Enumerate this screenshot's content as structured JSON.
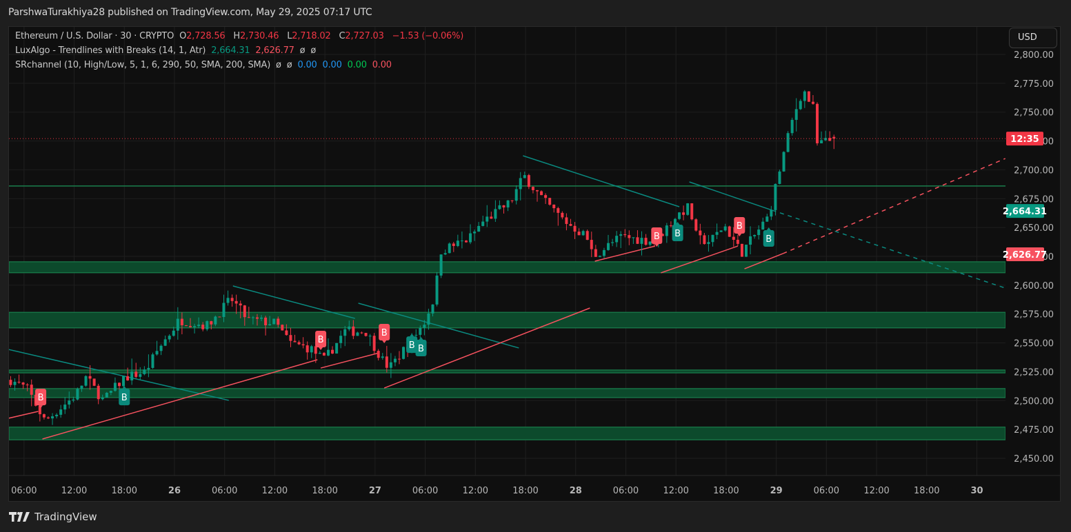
{
  "publisher": "ParshwaTurakhiya28 published on TradingView.com, May 29, 2025 07:17 UTC",
  "legend": {
    "symbol": "Ethereum / U.S. Dollar · 30 · CRYPTO",
    "o_label": "O",
    "o": "2,728.56",
    "h_label": "H",
    "h": "2,730.46",
    "l_label": "L",
    "l": "2,718.02",
    "c_label": "C",
    "c": "2,727.03",
    "change": "−1.53 (−0.06%)",
    "ind1_name": "LuxAlgo - Trendlines with Breaks (14, 1, Atr)",
    "ind1_v1": "2,664.31",
    "ind1_v2": "2,626.77",
    "ind1_v3": "ø",
    "ind1_v4": "ø",
    "ind2_name": "SRchannel (10, High/Low, 5, 1, 6, 290, 50, SMA, 200, SMA)",
    "ind2_v1": "ø",
    "ind2_v2": "ø",
    "ind2_v3": "0.00",
    "ind2_v4": "0.00",
    "ind2_v5": "0.00",
    "ind2_v6": "0.00"
  },
  "currency": "USD",
  "footer": {
    "brand": "TradingView"
  },
  "colors": {
    "up": "#089981",
    "down": "#f23645",
    "zone_fill": "#0c4a2c",
    "zone_border": "#1a7f4d",
    "teal_line": "#0a8a80",
    "red_line": "#f7525f",
    "bg": "#0f0f0f",
    "grid": "#1f1f1f"
  },
  "chart_data": {
    "type": "candlestick",
    "title": "Ethereum / U.S. Dollar · 30 · CRYPTO",
    "time_unit": "hours since May 25 00:00 UTC",
    "interval_hours": 0.5,
    "xlim": [
      3.1,
      122.3
    ],
    "ylim": [
      2435,
      2810
    ],
    "y_ticks": [
      2450,
      2475,
      2500,
      2525,
      2550,
      2575,
      2600,
      2625,
      2650,
      2675,
      2700,
      2725,
      2750,
      2775,
      2800
    ],
    "y_tick_labels": [
      "2,450.00",
      "2,475.00",
      "2,500.00",
      "2,525.00",
      "2,550.00",
      "2,575.00",
      "2,600.00",
      "2,625.00",
      "2,650.00",
      "2,675.00",
      "2,700.00",
      "2,725.00",
      "2,750.00",
      "2,775.00",
      "2,800.00"
    ],
    "x_ticks": [
      {
        "t": 6,
        "label": "06:00"
      },
      {
        "t": 12,
        "label": "12:00"
      },
      {
        "t": 18,
        "label": "18:00"
      },
      {
        "t": 24,
        "label": "26",
        "bold": true
      },
      {
        "t": 30,
        "label": "06:00"
      },
      {
        "t": 36,
        "label": "12:00"
      },
      {
        "t": 42,
        "label": "18:00"
      },
      {
        "t": 48,
        "label": "27",
        "bold": true
      },
      {
        "t": 54,
        "label": "06:00"
      },
      {
        "t": 60,
        "label": "12:00"
      },
      {
        "t": 66,
        "label": "18:00"
      },
      {
        "t": 72,
        "label": "28",
        "bold": true
      },
      {
        "t": 78,
        "label": "06:00"
      },
      {
        "t": 84,
        "label": "12:00"
      },
      {
        "t": 90,
        "label": "18:00"
      },
      {
        "t": 96,
        "label": "29",
        "bold": true
      },
      {
        "t": 102,
        "label": "06:00"
      },
      {
        "t": 108,
        "label": "12:00"
      },
      {
        "t": 114,
        "label": "18:00"
      },
      {
        "t": 120,
        "label": "30",
        "bold": true
      }
    ],
    "close_path": [
      [
        4.4,
        2518
      ],
      [
        6.4,
        2510
      ],
      [
        8.5,
        2482
      ],
      [
        12.2,
        2505
      ],
      [
        13.4,
        2520
      ],
      [
        15.5,
        2500
      ],
      [
        18.0,
        2520
      ],
      [
        20.5,
        2525
      ],
      [
        22.1,
        2545
      ],
      [
        24.6,
        2570
      ],
      [
        27.9,
        2565
      ],
      [
        30.8,
        2588
      ],
      [
        32.8,
        2570
      ],
      [
        36.1,
        2567
      ],
      [
        37.8,
        2550
      ],
      [
        40.3,
        2545
      ],
      [
        41.9,
        2535
      ],
      [
        44.4,
        2560
      ],
      [
        46.9,
        2560
      ],
      [
        48.9,
        2535
      ],
      [
        49.7,
        2528
      ],
      [
        52.6,
        2555
      ],
      [
        53.9,
        2568
      ],
      [
        55.1,
        2590
      ],
      [
        55.9,
        2630
      ],
      [
        59.2,
        2640
      ],
      [
        60.9,
        2655
      ],
      [
        64.2,
        2672
      ],
      [
        65.8,
        2695
      ],
      [
        68.3,
        2672
      ],
      [
        70.8,
        2655
      ],
      [
        73.3,
        2642
      ],
      [
        74.1,
        2625
      ],
      [
        77.4,
        2642
      ],
      [
        81.5,
        2638
      ],
      [
        84.0,
        2660
      ],
      [
        85.6,
        2668
      ],
      [
        86.5,
        2640
      ],
      [
        88.1,
        2638
      ],
      [
        89.8,
        2652
      ],
      [
        91.8,
        2628
      ],
      [
        93.1,
        2640
      ],
      [
        95.1,
        2660
      ],
      [
        96.4,
        2700
      ],
      [
        98.0,
        2745
      ],
      [
        99.2,
        2770
      ],
      [
        100.5,
        2752
      ],
      [
        100.9,
        2722
      ],
      [
        103.0,
        2727.03
      ]
    ],
    "last_candle": {
      "open": 2728.56,
      "high": 2730.46,
      "low": 2718.02,
      "close": 2727.03
    },
    "sr_zones": [
      [
        2610.8,
        2620.3
      ],
      [
        2563.0,
        2576.5
      ],
      [
        2524.0,
        2526.5
      ],
      [
        2502.6,
        2510.4
      ],
      [
        2466.0,
        2477.0
      ]
    ],
    "resistance_line": 2686,
    "current_price_line": 2727.03,
    "price_tags": [
      {
        "label": "12:35",
        "price": 2727.03,
        "color": "#f23645"
      },
      {
        "label": "2,664.31",
        "price": 2664.31,
        "color": "#089981"
      },
      {
        "label": "2,626.77",
        "price": 2626.77,
        "color": "#f7525f"
      }
    ],
    "trendlines_down": [
      [
        [
          4.1,
          2544.4
        ],
        [
          30.5,
          2500.2
        ]
      ],
      [
        [
          31.0,
          2599.3
        ],
        [
          45.6,
          2571.2
        ]
      ],
      [
        [
          46.0,
          2584.4
        ],
        [
          65.2,
          2545.6
        ]
      ],
      [
        [
          65.7,
          2712.2
        ],
        [
          84.4,
          2668.0
        ]
      ],
      [
        [
          85.6,
          2689.5
        ],
        [
          95.5,
          2665.0
        ],
        [
          123.4,
          2597.5
        ]
      ]
    ],
    "trendlines_up": [
      [
        [
          4.1,
          2484.6
        ],
        [
          7.7,
          2490.6
        ]
      ],
      [
        [
          8.2,
          2466.7
        ],
        [
          41.1,
          2535.4
        ]
      ],
      [
        [
          41.5,
          2528.2
        ],
        [
          48.5,
          2541.4
        ]
      ],
      [
        [
          49.1,
          2510.9
        ],
        [
          73.7,
          2580.2
        ]
      ],
      [
        [
          74.3,
          2620.8
        ],
        [
          81.5,
          2633.9
        ]
      ],
      [
        [
          82.2,
          2610.7
        ],
        [
          91.4,
          2633.9
        ]
      ],
      [
        [
          92.2,
          2614.2
        ],
        [
          96.8,
          2627.4
        ],
        [
          123.4,
          2709.8
        ]
      ]
    ],
    "break_labels": [
      {
        "t": 8.0,
        "price": 2503.1,
        "text": "B",
        "side": "bearish"
      },
      {
        "t": 18.0,
        "price": 2503.1,
        "text": "B",
        "side": "bullish"
      },
      {
        "t": 41.5,
        "price": 2553.3,
        "text": "B",
        "side": "bearish"
      },
      {
        "t": 49.1,
        "price": 2559.3,
        "text": "B",
        "side": "bearish"
      },
      {
        "t": 52.4,
        "price": 2548.5,
        "text": "B",
        "side": "bullish"
      },
      {
        "t": 53.5,
        "price": 2545.6,
        "text": "B",
        "side": "bullish"
      },
      {
        "t": 81.7,
        "price": 2642.9,
        "text": "B",
        "side": "bearish"
      },
      {
        "t": 84.2,
        "price": 2645.3,
        "text": "B",
        "side": "bullish"
      },
      {
        "t": 91.6,
        "price": 2651.9,
        "text": "B",
        "side": "bearish"
      },
      {
        "t": 95.1,
        "price": 2640.5,
        "text": "B",
        "side": "bullish"
      }
    ]
  }
}
